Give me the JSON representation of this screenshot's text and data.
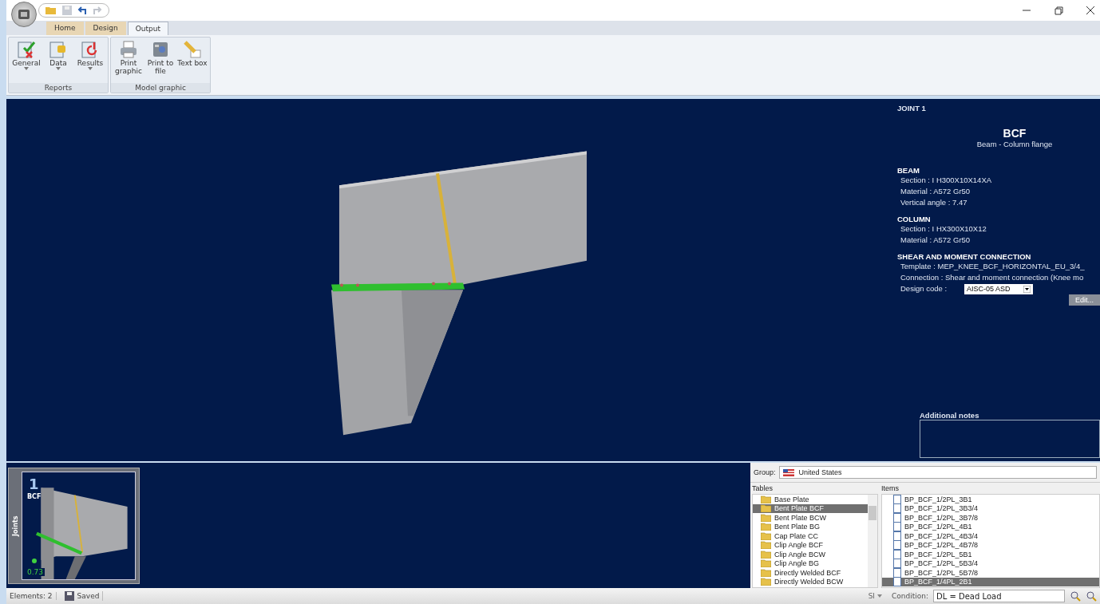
{
  "ribbon": {
    "tabs": [
      {
        "label": "Home",
        "selected": false
      },
      {
        "label": "Design",
        "selected": false
      },
      {
        "label": "Output",
        "selected": true
      }
    ],
    "groups": [
      {
        "label": "Reports",
        "buttons": [
          {
            "label": "General",
            "dropdown": true
          },
          {
            "label": "Data",
            "dropdown": true
          },
          {
            "label": "Results",
            "dropdown": true
          }
        ]
      },
      {
        "label": "Model graphic",
        "buttons": [
          {
            "label": "Print graphic",
            "dropdown": false
          },
          {
            "label": "Print to file",
            "dropdown": false
          },
          {
            "label": "Text box",
            "dropdown": false
          }
        ]
      }
    ]
  },
  "joint_info": {
    "title": "JOINT 1",
    "code": "BCF",
    "description": "Beam - Column flange",
    "sections": [
      {
        "heading": "BEAM",
        "lines": [
          "Section : I H300X10X14XA",
          "Material : A572 Gr50",
          "Vertical angle : 7.47"
        ]
      },
      {
        "heading": "COLUMN",
        "lines": [
          "Section : I HX300X10X12",
          "Material : A572 Gr50"
        ]
      },
      {
        "heading": "SHEAR AND MOMENT CONNECTION",
        "lines": [
          "Template : MEP_KNEE_BCF_HORIZONTAL_EU_3/4_",
          "Connection : Shear and moment connection (Knee mo"
        ]
      }
    ],
    "design_code_label": "Design code :",
    "design_code": "AISC-05 ASD",
    "edit_button": "Edit...",
    "notes_label": "Additional notes"
  },
  "joints_panel": {
    "tab": "Joints",
    "thumbnails": [
      {
        "number": "1",
        "code": "BCF",
        "ratio": "0.73",
        "color": "#3fd13f"
      }
    ]
  },
  "library": {
    "group_label": "Group:",
    "group": "United States",
    "tables_header": "Tables",
    "items_header": "Items",
    "tables": [
      {
        "label": "Base Plate",
        "selected": false
      },
      {
        "label": "Bent Plate BCF",
        "selected": true
      },
      {
        "label": "Bent Plate BCW",
        "selected": false
      },
      {
        "label": "Bent Plate BG",
        "selected": false
      },
      {
        "label": "Cap Plate CC",
        "selected": false
      },
      {
        "label": "Clip Angle BCF",
        "selected": false
      },
      {
        "label": "Clip Angle BCW",
        "selected": false
      },
      {
        "label": "Clip Angle BG",
        "selected": false
      },
      {
        "label": "Directly Welded BCF",
        "selected": false
      },
      {
        "label": "Directly Welded BCW",
        "selected": false
      }
    ],
    "items": [
      {
        "label": "BP_BCF_1/2PL_3B1",
        "selected": false
      },
      {
        "label": "BP_BCF_1/2PL_3B3/4",
        "selected": false
      },
      {
        "label": "BP_BCF_1/2PL_3B7/8",
        "selected": false
      },
      {
        "label": "BP_BCF_1/2PL_4B1",
        "selected": false
      },
      {
        "label": "BP_BCF_1/2PL_4B3/4",
        "selected": false
      },
      {
        "label": "BP_BCF_1/2PL_4B7/8",
        "selected": false
      },
      {
        "label": "BP_BCF_1/2PL_5B1",
        "selected": false
      },
      {
        "label": "BP_BCF_1/2PL_5B3/4",
        "selected": false
      },
      {
        "label": "BP_BCF_1/2PL_5B7/8",
        "selected": false
      },
      {
        "label": "BP_BCF_1/4PL_2B1",
        "selected": true
      }
    ]
  },
  "status_bar": {
    "elements": "Elements: 2",
    "saved": "Saved",
    "units": "SI",
    "condition_label": "Condition:",
    "condition": "DL = Dead Load"
  }
}
